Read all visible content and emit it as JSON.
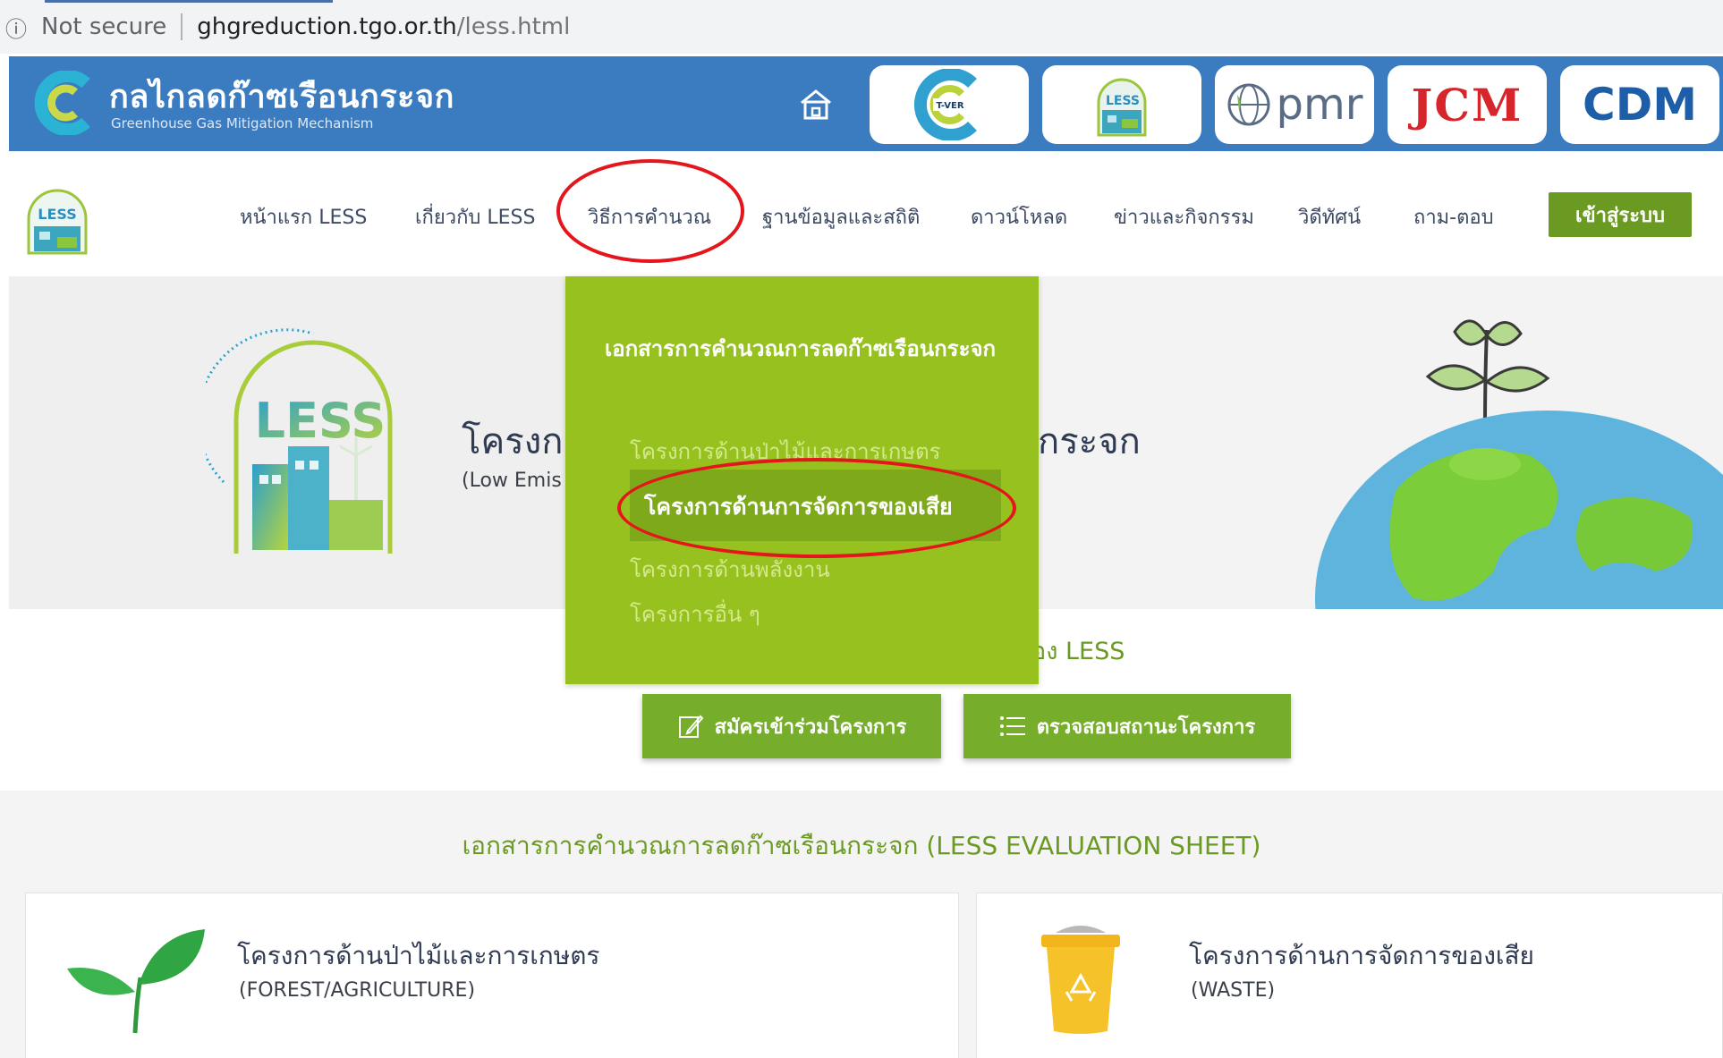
{
  "address_bar": {
    "info_icon": "info-icon",
    "security": "Not secure",
    "host": "ghgreduction.tgo.or.th",
    "path": "/less.html"
  },
  "header": {
    "title": "กลไกลดก๊าซเรือนกระจก",
    "subtitle": "Greenhouse Gas Mitigation Mechanism",
    "mechanisms": [
      {
        "label": "T-VER"
      },
      {
        "label": "LESS"
      },
      {
        "label": "pmr"
      },
      {
        "label": "JCM"
      },
      {
        "label": "CDM"
      }
    ]
  },
  "nav": {
    "items": [
      {
        "label": "หน้าแรก LESS"
      },
      {
        "label": "เกี่ยวกับ LESS"
      },
      {
        "label": "วิธีการคำนวณ"
      },
      {
        "label": "ฐานข้อมูลและสถิติ"
      },
      {
        "label": "ดาวน์โหลด"
      },
      {
        "label": "ข่าวและกิจกรรม"
      },
      {
        "label": "วิดีทัศน์"
      },
      {
        "label": "ถาม-ตอบ"
      }
    ],
    "login": "เข้าสู่ระบบ"
  },
  "hero": {
    "badge_label": "LESS",
    "badge_ring": "Low Emission Support Scheme",
    "title_start": "โครงกา",
    "title_end": "กระจก",
    "sub_start": "(Low Emis"
  },
  "dropdown": {
    "heading": "เอกสารการคำนวณการลดก๊าซเรือนกระจก",
    "items": [
      {
        "label": "โครงการด้านป่าไม้และการเกษตร"
      },
      {
        "label": "โครงการด้านการจัดการของเสีย"
      },
      {
        "label": "โครงการด้านพลังงาน"
      },
      {
        "label": "โครงการอื่น ๆ"
      }
    ]
  },
  "tagline_end": "อง LESS",
  "actions": {
    "apply": "สมัครเข้าร่วมโครงการ",
    "check": "ตรวจสอบสถานะโครงการ"
  },
  "evaluation": {
    "heading": "เอกสารการคำนวณการลดก๊าซเรือนกระจก (LESS EVALUATION SHEET)",
    "cards": [
      {
        "title": "โครงการด้านป่าไม้และการเกษตร",
        "sub": "(FOREST/AGRICULTURE)"
      },
      {
        "title": "โครงการด้านการจัดการของเสีย",
        "sub": "(WASTE)"
      }
    ]
  },
  "colors": {
    "header_blue": "#3b7bc0",
    "less_green": "#6a9a22",
    "dropdown_green": "#96c11f",
    "annotation_red": "#e4161b"
  }
}
